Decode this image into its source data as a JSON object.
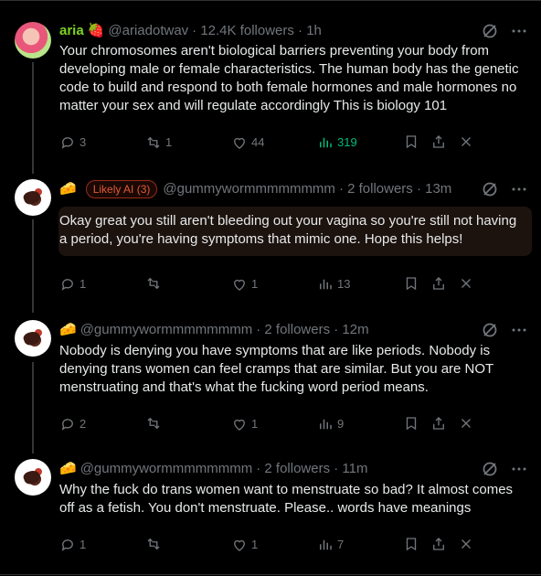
{
  "posts": [
    {
      "name": "aria",
      "emoji": "🍓",
      "handle": "@ariadotwav",
      "meta": "· 12.4K followers · 1h",
      "text": "Your chromosomes aren't biological barriers preventing your body from developing male or female characteristics. The human body has the genetic code to build and respond to both female hormones and male hormones no matter your sex and will regulate accordingly This is biology 101",
      "replies": "3",
      "reposts": "1",
      "likes": "44",
      "views": "319"
    },
    {
      "emoji": "🧀",
      "badge": "Likely AI (3)",
      "handle": "@gummywormmmmmmmm",
      "meta": "· 2 followers · 13m",
      "text": "Okay great you still aren't bleeding out your vagina so you're still not having a period, you're having symptoms that mimic one. Hope this helps!",
      "replies": "1",
      "reposts": "",
      "likes": "1",
      "views": "13"
    },
    {
      "emoji": "🧀",
      "handle": "@gummywormmmmmmmm",
      "meta": "· 2 followers · 12m",
      "text": "Nobody is denying you have symptoms that are like periods. Nobody is denying trans women can feel cramps that are similar. But you are NOT menstruating and that's what the fucking word period means.",
      "replies": "2",
      "reposts": "",
      "likes": "1",
      "views": "9"
    },
    {
      "emoji": "🧀",
      "handle": "@gummywormmmmmmmm",
      "meta": "· 2 followers · 11m",
      "text": "Why the fuck do trans women want to menstruate so bad? It almost comes off as a fetish. You don't menstruate. Please.. words have meanings",
      "replies": "1",
      "reposts": "",
      "likes": "1",
      "views": "7"
    }
  ],
  "colors": {
    "background": "#000000",
    "text": "#e7e9ea",
    "muted": "#71767b",
    "name_green": "#7ed321",
    "views_green": "#00ba7c",
    "likely_ai_badge": "#e05a38"
  },
  "icons": [
    "reply-icon",
    "repost-icon",
    "like-icon",
    "views-icon",
    "bookmark-icon",
    "share-icon",
    "close-icon",
    "grok-icon",
    "more-icon"
  ]
}
